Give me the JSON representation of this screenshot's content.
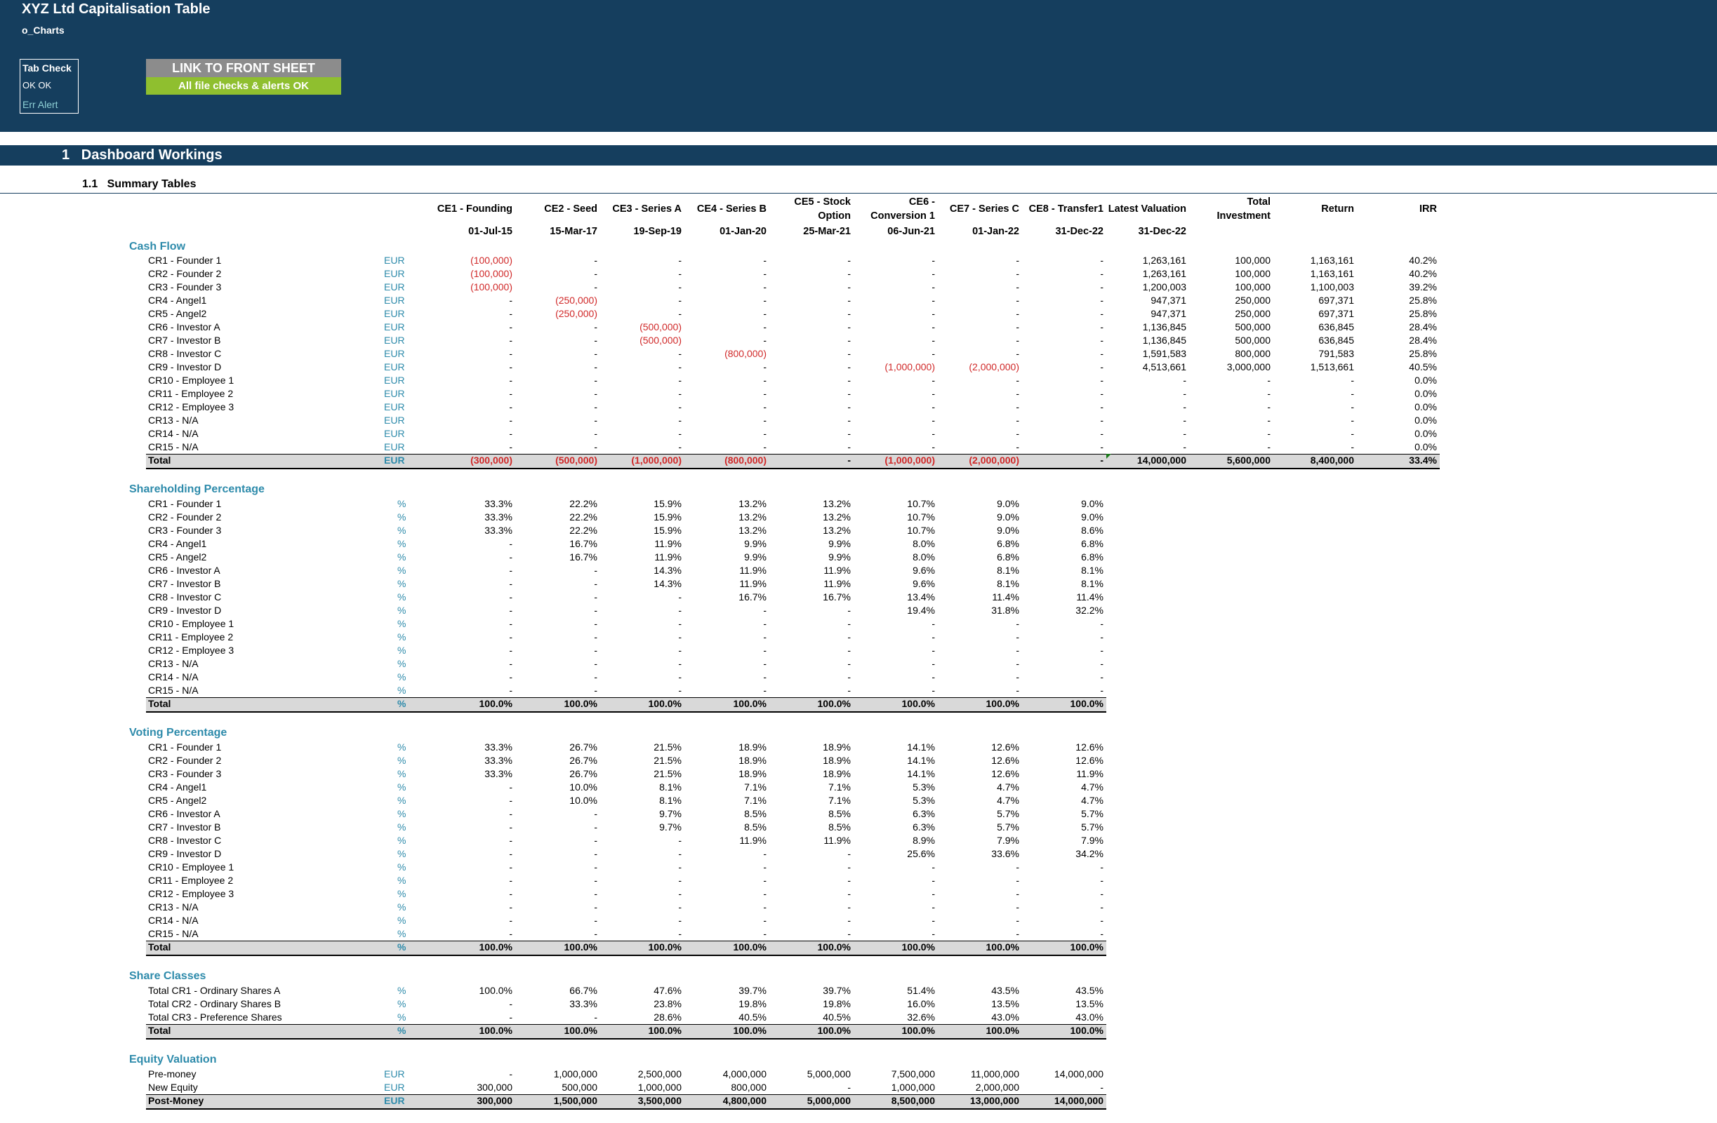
{
  "header": {
    "title": "XYZ Ltd Capitalisation Table",
    "sheet": "o_Charts",
    "tab_check": {
      "title": "Tab Check",
      "status": "OK  OK",
      "alert": "Err Alert"
    },
    "link_button": "LINK TO FRONT SHEET",
    "checks_status": "All file checks & alerts OK"
  },
  "section": {
    "number": "1",
    "title": "Dashboard Workings"
  },
  "subsection": {
    "number": "1.1",
    "title": "Summary Tables"
  },
  "columns": [
    {
      "l1": "",
      "l2": "CE1 - Founding",
      "date": "01-Jul-15"
    },
    {
      "l1": "",
      "l2": "CE2 - Seed",
      "date": "15-Mar-17"
    },
    {
      "l1": "",
      "l2": "CE3 - Series A",
      "date": "19-Sep-19"
    },
    {
      "l1": "",
      "l2": "CE4 - Series B",
      "date": "01-Jan-20"
    },
    {
      "l1": "CE5 - Stock",
      "l2": "Option",
      "date": "25-Mar-21"
    },
    {
      "l1": "CE6 -",
      "l2": "Conversion 1",
      "date": "06-Jun-21"
    },
    {
      "l1": "",
      "l2": "CE7 - Series C",
      "date": "01-Jan-22"
    },
    {
      "l1": "",
      "l2": "CE8 - Transfer1",
      "date": "31-Dec-22"
    },
    {
      "l1": "",
      "l2": "Latest Valuation",
      "date": "31-Dec-22"
    },
    {
      "l1": "Total",
      "l2": "Investment",
      "date": ""
    },
    {
      "l1": "",
      "l2": "Return",
      "date": ""
    },
    {
      "l1": "",
      "l2": "IRR",
      "date": ""
    }
  ],
  "cash_flow": {
    "title": "Cash Flow",
    "unit": "EUR",
    "rows": [
      {
        "label": "CR1 - Founder 1",
        "values": [
          "(100,000)",
          "-",
          "-",
          "-",
          "-",
          "-",
          "-",
          "-",
          "1,263,161",
          "100,000",
          "1,163,161",
          "40.2%"
        ]
      },
      {
        "label": "CR2 - Founder 2",
        "values": [
          "(100,000)",
          "-",
          "-",
          "-",
          "-",
          "-",
          "-",
          "-",
          "1,263,161",
          "100,000",
          "1,163,161",
          "40.2%"
        ]
      },
      {
        "label": "CR3 - Founder 3",
        "values": [
          "(100,000)",
          "-",
          "-",
          "-",
          "-",
          "-",
          "-",
          "-",
          "1,200,003",
          "100,000",
          "1,100,003",
          "39.2%"
        ]
      },
      {
        "label": "CR4 - Angel1",
        "values": [
          "-",
          "(250,000)",
          "-",
          "-",
          "-",
          "-",
          "-",
          "-",
          "947,371",
          "250,000",
          "697,371",
          "25.8%"
        ]
      },
      {
        "label": "CR5 - Angel2",
        "values": [
          "-",
          "(250,000)",
          "-",
          "-",
          "-",
          "-",
          "-",
          "-",
          "947,371",
          "250,000",
          "697,371",
          "25.8%"
        ]
      },
      {
        "label": "CR6 - Investor A",
        "values": [
          "-",
          "-",
          "(500,000)",
          "-",
          "-",
          "-",
          "-",
          "-",
          "1,136,845",
          "500,000",
          "636,845",
          "28.4%"
        ]
      },
      {
        "label": "CR7 - Investor B",
        "values": [
          "-",
          "-",
          "(500,000)",
          "-",
          "-",
          "-",
          "-",
          "-",
          "1,136,845",
          "500,000",
          "636,845",
          "28.4%"
        ]
      },
      {
        "label": "CR8 - Investor C",
        "values": [
          "-",
          "-",
          "-",
          "(800,000)",
          "-",
          "-",
          "-",
          "-",
          "1,591,583",
          "800,000",
          "791,583",
          "25.8%"
        ]
      },
      {
        "label": "CR9 - Investor D",
        "values": [
          "-",
          "-",
          "-",
          "-",
          "-",
          "(1,000,000)",
          "(2,000,000)",
          "-",
          "4,513,661",
          "3,000,000",
          "1,513,661",
          "40.5%"
        ]
      },
      {
        "label": "CR10 - Employee 1",
        "values": [
          "-",
          "-",
          "-",
          "-",
          "-",
          "-",
          "-",
          "-",
          "-",
          "-",
          "-",
          "0.0%"
        ]
      },
      {
        "label": "CR11 - Employee 2",
        "values": [
          "-",
          "-",
          "-",
          "-",
          "-",
          "-",
          "-",
          "-",
          "-",
          "-",
          "-",
          "0.0%"
        ]
      },
      {
        "label": "CR12 - Employee 3",
        "values": [
          "-",
          "-",
          "-",
          "-",
          "-",
          "-",
          "-",
          "-",
          "-",
          "-",
          "-",
          "0.0%"
        ]
      },
      {
        "label": "CR13 - N/A",
        "values": [
          "-",
          "-",
          "-",
          "-",
          "-",
          "-",
          "-",
          "-",
          "-",
          "-",
          "-",
          "0.0%"
        ]
      },
      {
        "label": "CR14 - N/A",
        "values": [
          "-",
          "-",
          "-",
          "-",
          "-",
          "-",
          "-",
          "-",
          "-",
          "-",
          "-",
          "0.0%"
        ]
      },
      {
        "label": "CR15 - N/A",
        "values": [
          "-",
          "-",
          "-",
          "-",
          "-",
          "-",
          "-",
          "-",
          "-",
          "-",
          "-",
          "0.0%"
        ]
      }
    ],
    "total": {
      "label": "Total",
      "values": [
        "(300,000)",
        "(500,000)",
        "(1,000,000)",
        "(800,000)",
        "-",
        "(1,000,000)",
        "(2,000,000)",
        "-",
        "14,000,000",
        "5,600,000",
        "8,400,000",
        "33.4%"
      ]
    }
  },
  "shareholding": {
    "title": "Shareholding Percentage",
    "unit": "%",
    "rows": [
      {
        "label": "CR1 - Founder 1",
        "values": [
          "33.3%",
          "22.2%",
          "15.9%",
          "13.2%",
          "13.2%",
          "10.7%",
          "9.0%",
          "9.0%"
        ]
      },
      {
        "label": "CR2 - Founder 2",
        "values": [
          "33.3%",
          "22.2%",
          "15.9%",
          "13.2%",
          "13.2%",
          "10.7%",
          "9.0%",
          "9.0%"
        ]
      },
      {
        "label": "CR3 - Founder 3",
        "values": [
          "33.3%",
          "22.2%",
          "15.9%",
          "13.2%",
          "13.2%",
          "10.7%",
          "9.0%",
          "8.6%"
        ]
      },
      {
        "label": "CR4 - Angel1",
        "values": [
          "-",
          "16.7%",
          "11.9%",
          "9.9%",
          "9.9%",
          "8.0%",
          "6.8%",
          "6.8%"
        ]
      },
      {
        "label": "CR5 - Angel2",
        "values": [
          "-",
          "16.7%",
          "11.9%",
          "9.9%",
          "9.9%",
          "8.0%",
          "6.8%",
          "6.8%"
        ]
      },
      {
        "label": "CR6 - Investor A",
        "values": [
          "-",
          "-",
          "14.3%",
          "11.9%",
          "11.9%",
          "9.6%",
          "8.1%",
          "8.1%"
        ]
      },
      {
        "label": "CR7 - Investor B",
        "values": [
          "-",
          "-",
          "14.3%",
          "11.9%",
          "11.9%",
          "9.6%",
          "8.1%",
          "8.1%"
        ]
      },
      {
        "label": "CR8 - Investor C",
        "values": [
          "-",
          "-",
          "-",
          "16.7%",
          "16.7%",
          "13.4%",
          "11.4%",
          "11.4%"
        ]
      },
      {
        "label": "CR9 - Investor D",
        "values": [
          "-",
          "-",
          "-",
          "-",
          "-",
          "19.4%",
          "31.8%",
          "32.2%"
        ]
      },
      {
        "label": "CR10 - Employee 1",
        "values": [
          "-",
          "-",
          "-",
          "-",
          "-",
          "-",
          "-",
          "-"
        ]
      },
      {
        "label": "CR11 - Employee 2",
        "values": [
          "-",
          "-",
          "-",
          "-",
          "-",
          "-",
          "-",
          "-"
        ]
      },
      {
        "label": "CR12 - Employee 3",
        "values": [
          "-",
          "-",
          "-",
          "-",
          "-",
          "-",
          "-",
          "-"
        ]
      },
      {
        "label": "CR13 - N/A",
        "values": [
          "-",
          "-",
          "-",
          "-",
          "-",
          "-",
          "-",
          "-"
        ]
      },
      {
        "label": "CR14 - N/A",
        "values": [
          "-",
          "-",
          "-",
          "-",
          "-",
          "-",
          "-",
          "-"
        ]
      },
      {
        "label": "CR15 - N/A",
        "values": [
          "-",
          "-",
          "-",
          "-",
          "-",
          "-",
          "-",
          "-"
        ]
      }
    ],
    "total": {
      "label": "Total",
      "values": [
        "100.0%",
        "100.0%",
        "100.0%",
        "100.0%",
        "100.0%",
        "100.0%",
        "100.0%",
        "100.0%"
      ]
    }
  },
  "voting": {
    "title": "Voting Percentage",
    "unit": "%",
    "rows": [
      {
        "label": "CR1 - Founder 1",
        "values": [
          "33.3%",
          "26.7%",
          "21.5%",
          "18.9%",
          "18.9%",
          "14.1%",
          "12.6%",
          "12.6%"
        ]
      },
      {
        "label": "CR2 - Founder 2",
        "values": [
          "33.3%",
          "26.7%",
          "21.5%",
          "18.9%",
          "18.9%",
          "14.1%",
          "12.6%",
          "12.6%"
        ]
      },
      {
        "label": "CR3 - Founder 3",
        "values": [
          "33.3%",
          "26.7%",
          "21.5%",
          "18.9%",
          "18.9%",
          "14.1%",
          "12.6%",
          "11.9%"
        ]
      },
      {
        "label": "CR4 - Angel1",
        "values": [
          "-",
          "10.0%",
          "8.1%",
          "7.1%",
          "7.1%",
          "5.3%",
          "4.7%",
          "4.7%"
        ]
      },
      {
        "label": "CR5 - Angel2",
        "values": [
          "-",
          "10.0%",
          "8.1%",
          "7.1%",
          "7.1%",
          "5.3%",
          "4.7%",
          "4.7%"
        ]
      },
      {
        "label": "CR6 - Investor A",
        "values": [
          "-",
          "-",
          "9.7%",
          "8.5%",
          "8.5%",
          "6.3%",
          "5.7%",
          "5.7%"
        ]
      },
      {
        "label": "CR7 - Investor B",
        "values": [
          "-",
          "-",
          "9.7%",
          "8.5%",
          "8.5%",
          "6.3%",
          "5.7%",
          "5.7%"
        ]
      },
      {
        "label": "CR8 - Investor C",
        "values": [
          "-",
          "-",
          "-",
          "11.9%",
          "11.9%",
          "8.9%",
          "7.9%",
          "7.9%"
        ]
      },
      {
        "label": "CR9 - Investor D",
        "values": [
          "-",
          "-",
          "-",
          "-",
          "-",
          "25.6%",
          "33.6%",
          "34.2%"
        ]
      },
      {
        "label": "CR10 - Employee 1",
        "values": [
          "-",
          "-",
          "-",
          "-",
          "-",
          "-",
          "-",
          "-"
        ]
      },
      {
        "label": "CR11 - Employee 2",
        "values": [
          "-",
          "-",
          "-",
          "-",
          "-",
          "-",
          "-",
          "-"
        ]
      },
      {
        "label": "CR12 - Employee 3",
        "values": [
          "-",
          "-",
          "-",
          "-",
          "-",
          "-",
          "-",
          "-"
        ]
      },
      {
        "label": "CR13 - N/A",
        "values": [
          "-",
          "-",
          "-",
          "-",
          "-",
          "-",
          "-",
          "-"
        ]
      },
      {
        "label": "CR14 - N/A",
        "values": [
          "-",
          "-",
          "-",
          "-",
          "-",
          "-",
          "-",
          "-"
        ]
      },
      {
        "label": "CR15 - N/A",
        "values": [
          "-",
          "-",
          "-",
          "-",
          "-",
          "-",
          "-",
          "-"
        ]
      }
    ],
    "total": {
      "label": "Total",
      "values": [
        "100.0%",
        "100.0%",
        "100.0%",
        "100.0%",
        "100.0%",
        "100.0%",
        "100.0%",
        "100.0%"
      ]
    }
  },
  "share_classes": {
    "title": "Share Classes",
    "unit": "%",
    "rows": [
      {
        "label": "Total CR1 - Ordinary Shares A",
        "values": [
          "100.0%",
          "66.7%",
          "47.6%",
          "39.7%",
          "39.7%",
          "51.4%",
          "43.5%",
          "43.5%"
        ]
      },
      {
        "label": "Total CR2 - Ordinary Shares B",
        "values": [
          "-",
          "33.3%",
          "23.8%",
          "19.8%",
          "19.8%",
          "16.0%",
          "13.5%",
          "13.5%"
        ]
      },
      {
        "label": "Total CR3 - Preference Shares",
        "values": [
          "-",
          "-",
          "28.6%",
          "40.5%",
          "40.5%",
          "32.6%",
          "43.0%",
          "43.0%"
        ]
      }
    ],
    "total": {
      "label": "Total",
      "values": [
        "100.0%",
        "100.0%",
        "100.0%",
        "100.0%",
        "100.0%",
        "100.0%",
        "100.0%",
        "100.0%"
      ]
    }
  },
  "equity_valuation": {
    "title": "Equity Valuation",
    "unit": "EUR",
    "rows": [
      {
        "label": "Pre-money",
        "values": [
          "-",
          "1,000,000",
          "2,500,000",
          "4,000,000",
          "5,000,000",
          "7,500,000",
          "11,000,000",
          "14,000,000"
        ]
      },
      {
        "label": "New Equity",
        "values": [
          "300,000",
          "500,000",
          "1,000,000",
          "800,000",
          "-",
          "1,000,000",
          "2,000,000",
          "-"
        ]
      }
    ],
    "total": {
      "label": "Post-Money",
      "values": [
        "300,000",
        "1,500,000",
        "3,500,000",
        "4,800,000",
        "5,000,000",
        "8,500,000",
        "13,000,000",
        "14,000,000"
      ]
    }
  },
  "colors": {
    "header_bg": "#153e5e",
    "accent_text": "#2e8bab",
    "negative": "#d02828",
    "ok_green": "#8fbf2f",
    "link_gray": "#8c8c8c"
  }
}
